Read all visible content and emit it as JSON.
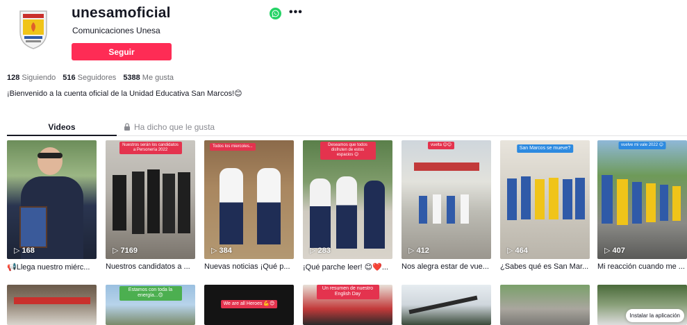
{
  "profile": {
    "username": "unesamoficial",
    "nickname": "Comunicaciones Unesa",
    "follow_label": "Seguir",
    "bio": "¡Bienvenido a la cuenta oficial de la Unidad Educativa San Marcos!😊",
    "stats": {
      "following_count": "128",
      "following_label": "Siguiendo",
      "followers_count": "516",
      "followers_label": "Seguidores",
      "likes_count": "5388",
      "likes_label": "Me gusta"
    },
    "more_glyph": "•••"
  },
  "tabs": {
    "videos": "Videos",
    "liked": "Ha dicho que le gusta"
  },
  "videos": [
    {
      "views": "168",
      "caption": "📢Llega nuestro miérc...",
      "overlay": ""
    },
    {
      "views": "7169",
      "caption": "Nuestros candidatos a ...",
      "overlay": "Nuestros serán los candidatos a Personería 2022"
    },
    {
      "views": "384",
      "caption": "Nuevas noticias ¡Qué p...",
      "overlay": "Todos los miercoles..."
    },
    {
      "views": "283",
      "caption": "¡Qué parche leer! 😊❤️...",
      "overlay": "Deseamos que todos disfruten de estos espacios 😊"
    },
    {
      "views": "412",
      "caption": "Nos alegra estar de vue...",
      "overlay": "vuelta 😊😊"
    },
    {
      "views": "464",
      "caption": "¿Sabes qué es San Mar...",
      "overlay": "San Marcos se mueve?"
    },
    {
      "views": "407",
      "caption": "Mi reacción cuando me ...",
      "overlay": "vuelve mi vale 2022 😊"
    }
  ],
  "row2_overlays": [
    "",
    "Estamos con toda la energía...😊",
    "We are all Heroes 💪😊",
    "Un resumen de nuestro English Day",
    "",
    "",
    ""
  ],
  "install_label": "Instalar la aplicación",
  "colors": {
    "accent": "#fe2c55",
    "whatsapp": "#25d366"
  },
  "icons": {
    "more": "more-icon",
    "whatsapp": "whatsapp-icon",
    "lock": "lock-icon",
    "play": "play-icon"
  }
}
